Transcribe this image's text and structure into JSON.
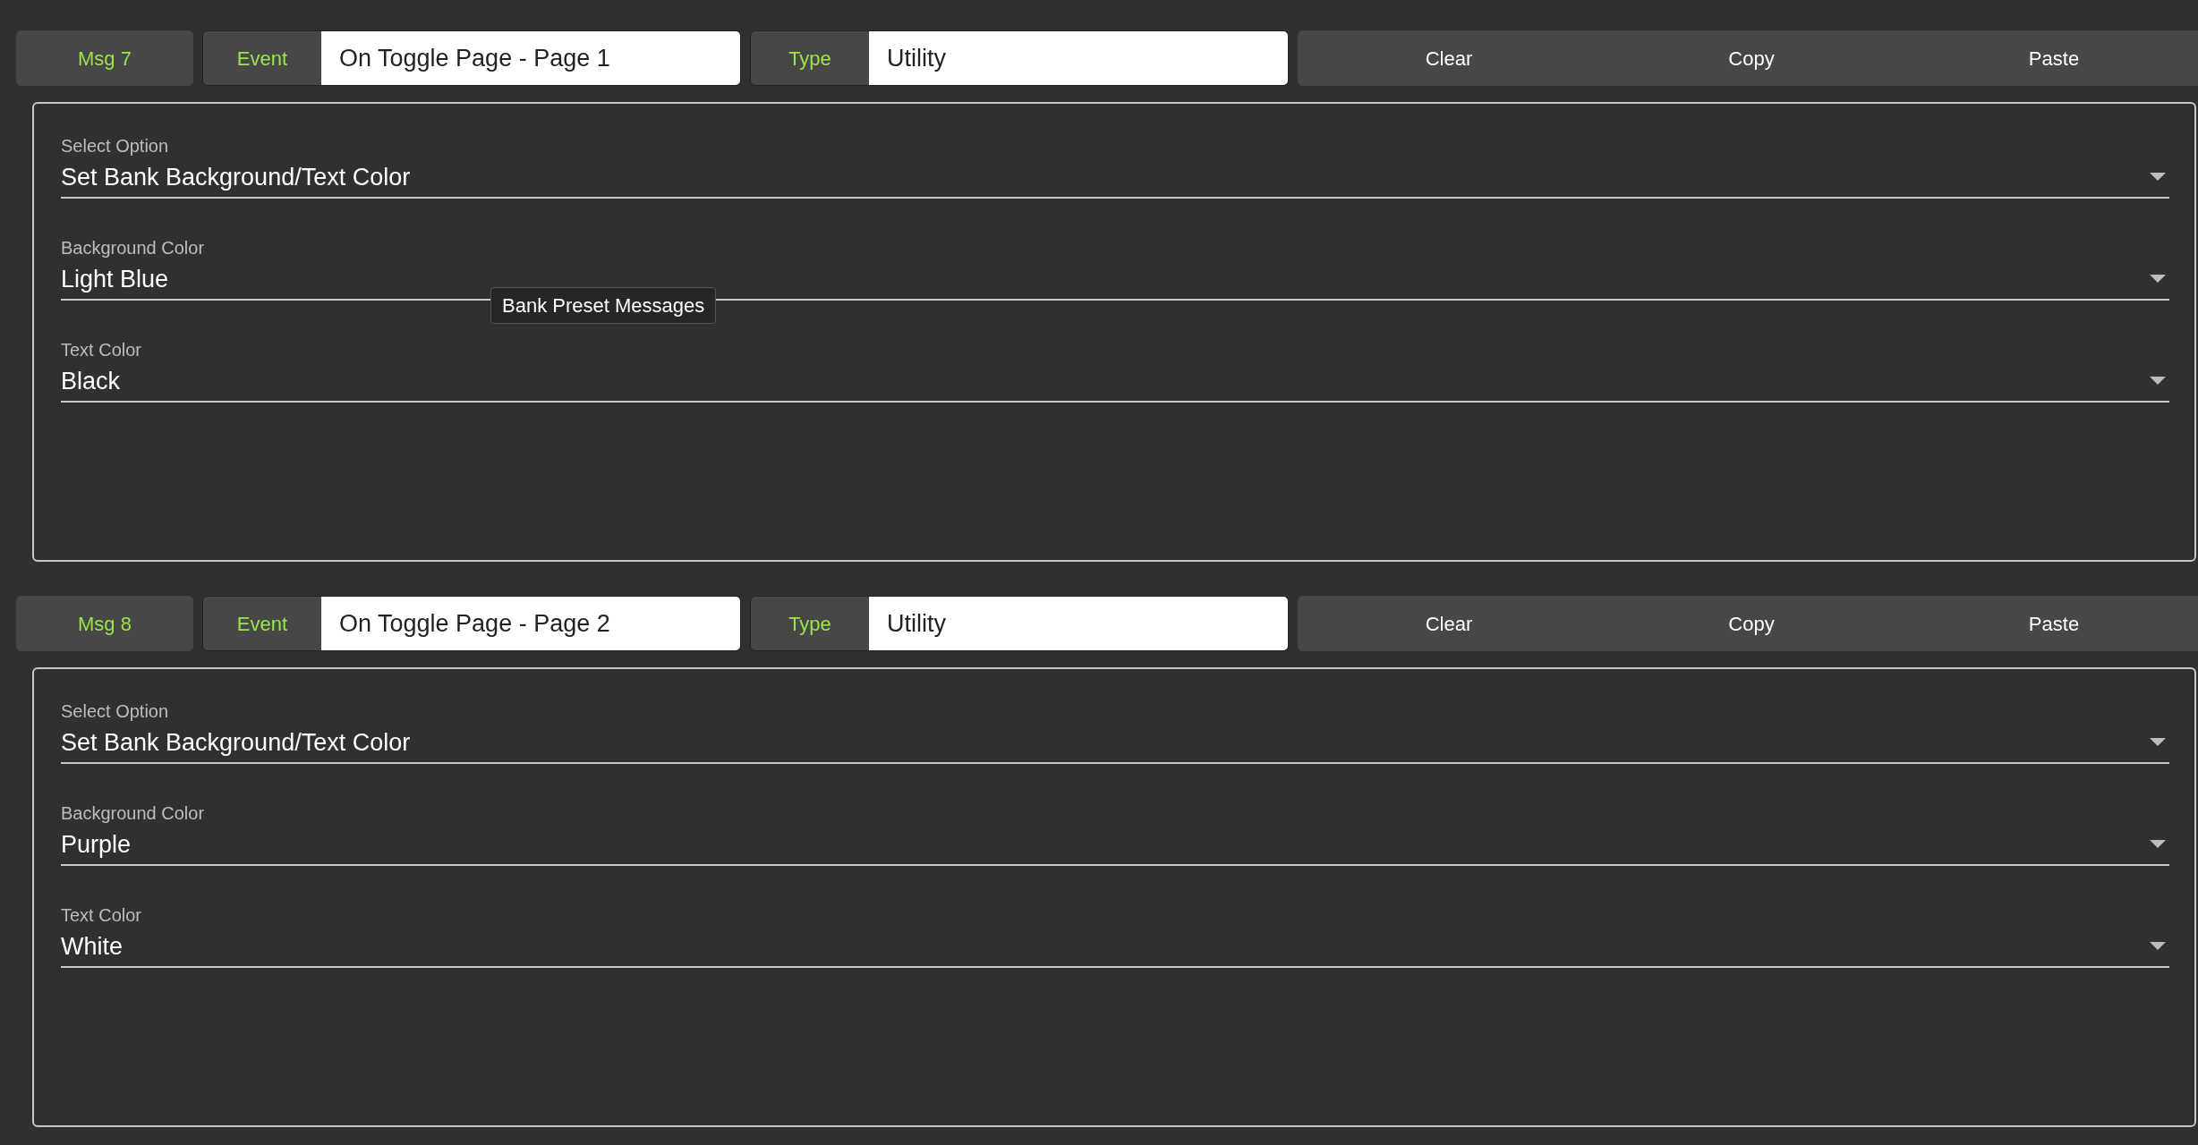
{
  "messages": [
    {
      "msg": "Msg 7",
      "event_label": "Event",
      "event_value": "On Toggle Page - Page 1",
      "type_label": "Type",
      "type_value": "Utility",
      "buttons": [
        "Clear",
        "Copy",
        "Paste"
      ],
      "fields": [
        {
          "label": "Select Option",
          "value": "Set Bank Background/Text Color"
        },
        {
          "label": "Background Color",
          "value": "Light Blue"
        },
        {
          "label": "Text Color",
          "value": "Black"
        }
      ]
    },
    {
      "msg": "Msg 8",
      "event_label": "Event",
      "event_value": "On Toggle Page - Page 2",
      "type_label": "Type",
      "type_value": "Utility",
      "buttons": [
        "Clear",
        "Copy",
        "Paste"
      ],
      "fields": [
        {
          "label": "Select Option",
          "value": "Set Bank Background/Text Color"
        },
        {
          "label": "Background Color",
          "value": "Purple"
        },
        {
          "label": "Text Color",
          "value": "White"
        }
      ]
    }
  ],
  "tooltip": {
    "text": "Bank Preset Messages"
  }
}
